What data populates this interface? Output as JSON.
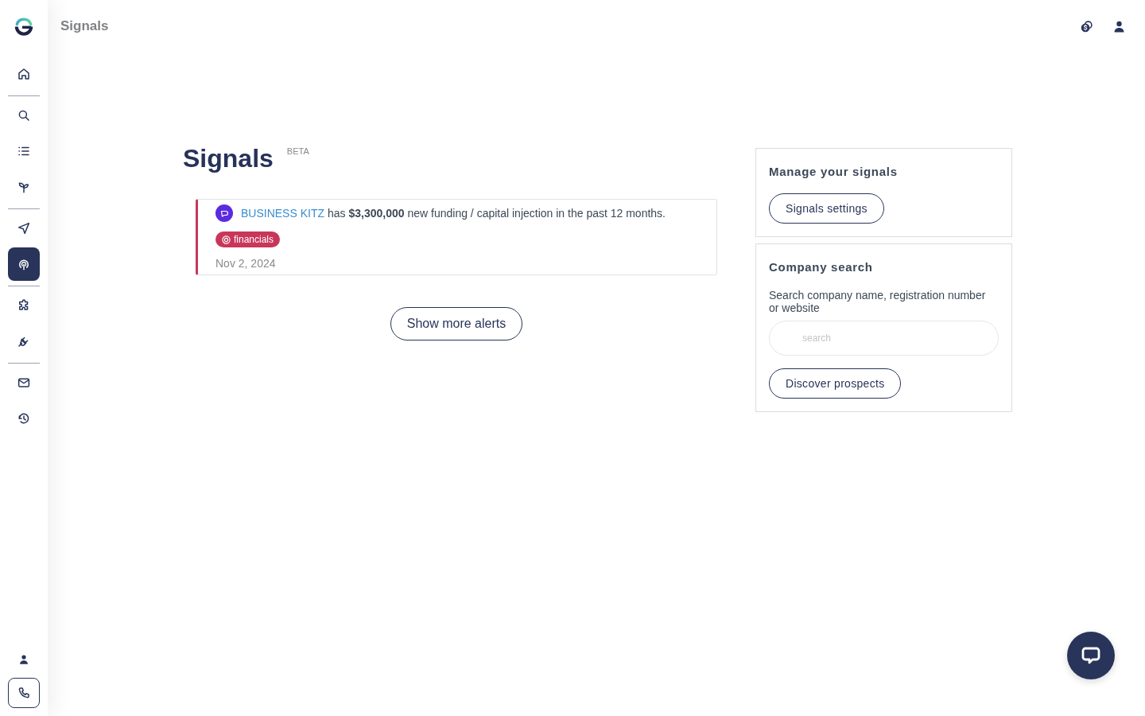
{
  "topbar": {
    "title": "Signals"
  },
  "sidebar": {
    "groups": [
      {
        "items": [
          {
            "selected": false
          }
        ]
      },
      {
        "items": [
          {
            "selected": false
          },
          {
            "selected": false
          },
          {
            "selected": false
          }
        ]
      },
      {
        "items": [
          {
            "selected": false
          },
          {
            "selected": true
          }
        ]
      },
      {
        "items": [
          {
            "selected": false
          },
          {
            "selected": false
          }
        ]
      },
      {
        "items": [
          {
            "selected": false
          },
          {
            "selected": false
          }
        ]
      }
    ]
  },
  "page": {
    "title": "Signals",
    "badge": "BETA"
  },
  "alerts": [
    {
      "company": "BUSINESS KITZ",
      "message": "has **$3,300,000** new funding / capital injection in the past 12 months.",
      "tag": "financials",
      "date": "Nov 2, 2024"
    }
  ],
  "show_more_button": "Show more alerts",
  "manage_panel": {
    "title": "Manage your signals",
    "button": "Signals settings"
  },
  "company_search": {
    "title": "Company search",
    "description": "Search company name, registration number or website",
    "search": {
      "placeholder": "search"
    },
    "button": "Discover prospects"
  }
}
